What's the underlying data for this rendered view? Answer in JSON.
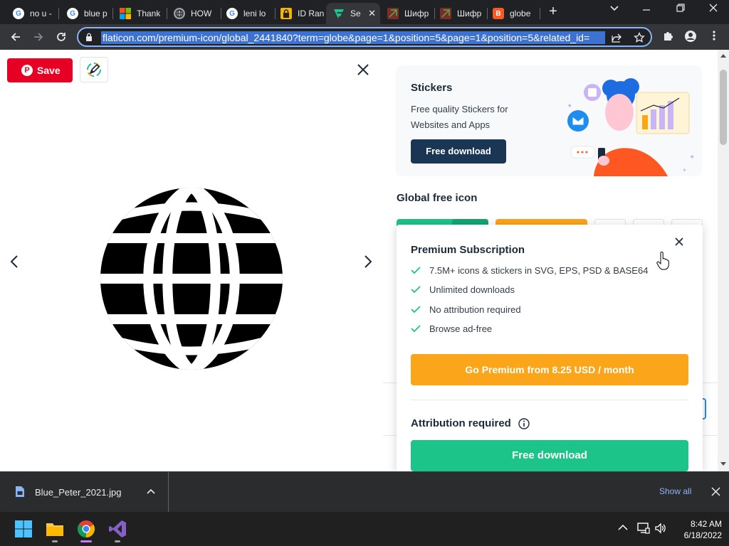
{
  "browser": {
    "tabs": [
      {
        "label": "no u -",
        "favicon": "google-icon",
        "color": "#4285f4"
      },
      {
        "label": "blue p",
        "favicon": "google-icon",
        "color": "#4285f4"
      },
      {
        "label": "Thank",
        "favicon": "microsoft-icon",
        "color": "#f25022"
      },
      {
        "label": "HOW",
        "favicon": "globe-icon",
        "color": "#9aa0a6"
      },
      {
        "label": "leni lo",
        "favicon": "google-icon",
        "color": "#4285f4"
      },
      {
        "label": "ID Ran",
        "favicon": "lock-icon",
        "color": "#f4b400"
      },
      {
        "label": "Se",
        "favicon": "flaticon-icon",
        "color": "#1cc489",
        "active": true
      },
      {
        "label": "Шифр",
        "favicon": "cipher-icon",
        "color": "#c0392b"
      },
      {
        "label": "Шифр",
        "favicon": "cipher-icon",
        "color": "#c0392b"
      },
      {
        "label": "globe",
        "favicon": "blogger-icon",
        "color": "#ff5722"
      }
    ],
    "url": "flaticon.com/premium-icon/global_2441840?term=globe&page=1&position=5&page=1&position=5&related_id="
  },
  "preview": {
    "save_label": "Save",
    "icon_name": "globe-icon"
  },
  "stickers": {
    "title": "Stickers",
    "description": "Free quality Stickers for Websites and Apps",
    "button": "Free download"
  },
  "icon_title": "Global free icon",
  "premium_popup": {
    "title": "Premium Subscription",
    "features": [
      "7.5M+ icons & stickers in SVG, EPS, PSD & BASE64",
      "Unlimited downloads",
      "No attribution required",
      "Browse ad-free"
    ],
    "premium_button": "Go Premium from 8.25 USD / month",
    "attribution_label": "Attribution required",
    "free_button": "Free download"
  },
  "colors": {
    "premium": "#fba51a",
    "free": "#1cc489",
    "pinterest": "#e60023",
    "navy": "#1a3654"
  },
  "downloads": {
    "filename": "Blue_Peter_2021.jpg",
    "show_all": "Show all"
  },
  "taskbar": {
    "time": "8:42 AM",
    "date": "6/18/2022"
  }
}
